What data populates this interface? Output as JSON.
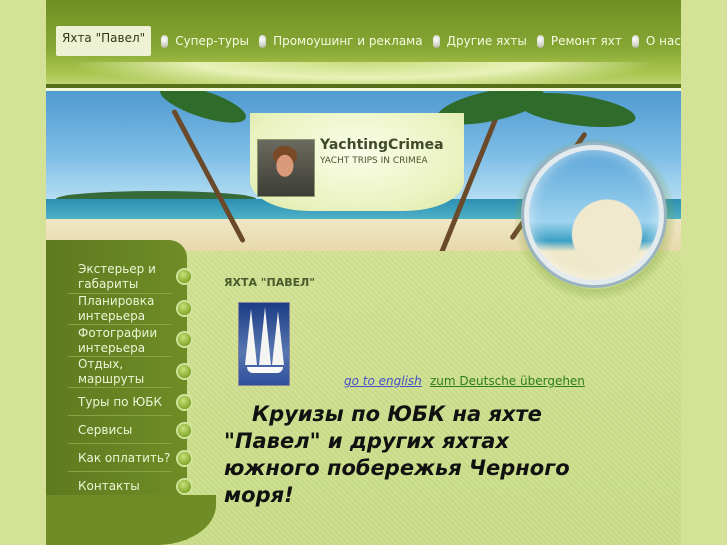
{
  "nav": {
    "items": [
      {
        "label": "Яхта \"Павел\"",
        "active": true
      },
      {
        "label": "Супер-туры"
      },
      {
        "label": "Промоушинг и реклама"
      },
      {
        "label": "Другие яхты"
      },
      {
        "label": "Ремонт яхт"
      },
      {
        "label": "О нас"
      }
    ]
  },
  "header": {
    "site_title": "YachtingCrimea",
    "site_subtitle": "YACHT TRIPS IN CRIMEA"
  },
  "sidebar": {
    "items": [
      {
        "label": "Экстерьер и габариты"
      },
      {
        "label": "Планировка интерьера"
      },
      {
        "label": "Фотографии интерьера"
      },
      {
        "label": "Отдых, маршруты"
      },
      {
        "label": "Туры по ЮБК"
      },
      {
        "label": "Сервисы"
      },
      {
        "label": "Как оплатить?"
      },
      {
        "label": "Контакты"
      }
    ]
  },
  "main": {
    "heading": "ЯХТА \"ПАВЕЛ\"",
    "link_english": "go to english",
    "link_german": "zum Deutsche übergehen",
    "intro": "Круизы по ЮБК на яхте \"Павел\" и других яхтах южного побережья Черного моря!"
  },
  "colors": {
    "nav_bg": "#7a9a2a",
    "sidebar_bg": "#6a8725",
    "page_bg": "#cfe08f",
    "link_english": "#4450c8",
    "link_german": "#2d7d1f"
  }
}
